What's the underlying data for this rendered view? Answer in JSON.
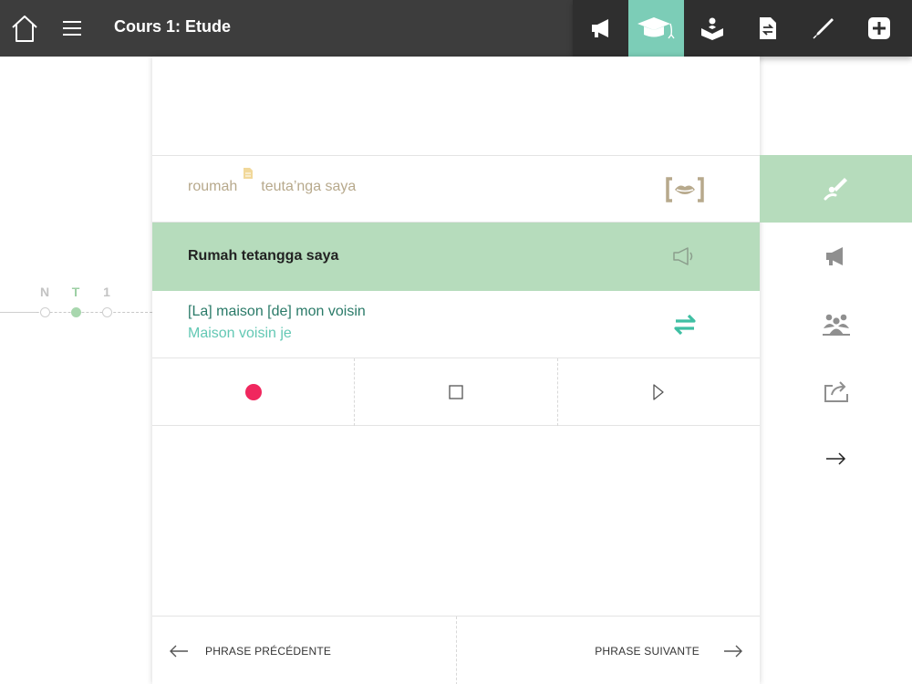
{
  "header": {
    "title": "Cours 1: Etude",
    "tools": [
      "megaphone-icon",
      "graduation-icon",
      "reading-icon",
      "document-swap-icon",
      "pen-icon",
      "add-icon"
    ],
    "active_tool": "graduation-icon"
  },
  "progress": {
    "steps": [
      {
        "label": "N",
        "active": false
      },
      {
        "label": "T",
        "active": true
      },
      {
        "label": "1",
        "active": false
      }
    ]
  },
  "phrase": {
    "phonetic_word1": "roumah",
    "phonetic_word2": "teuta’nga saya",
    "target": "Rumah tetangga saya",
    "literal_translation": "[La] maison [de] mon voisin",
    "word_translation": "Maison voisin je"
  },
  "recorder": {
    "record_color": "#f0275e"
  },
  "nav": {
    "prev_label": "PHRASE PRÉCÉDENTE",
    "next_label": "PHRASE SUIVANTE"
  },
  "sidebar": {
    "items": [
      "brush-icon",
      "megaphone-icon",
      "group-icon",
      "share-icon",
      "arrow-right-icon"
    ],
    "active_item": "brush-icon"
  },
  "colors": {
    "topbar": "#3d3d3d",
    "accent_teal": "#7ccdb7",
    "highlight_green": "#b6dcbc",
    "phonetic_text": "#b7a98c",
    "translation_teal": "#63c8b4"
  }
}
